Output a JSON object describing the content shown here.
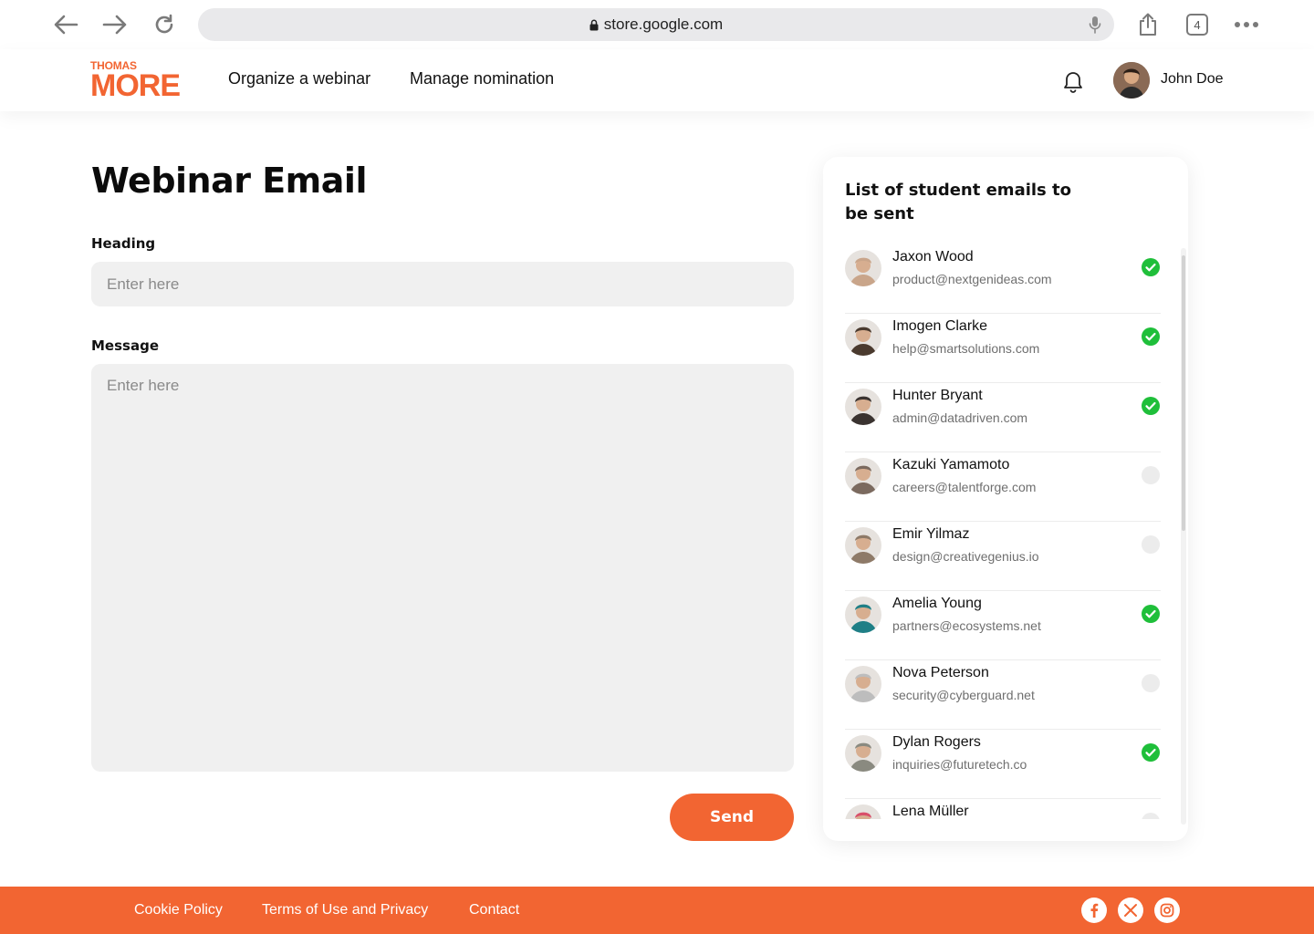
{
  "browser": {
    "url": "store.google.com",
    "tab_count": "4"
  },
  "header": {
    "logo": {
      "top": "THOMAS",
      "main": "MORE"
    },
    "nav": [
      "Organize a webinar",
      "Manage nomination"
    ],
    "user_name": "John Doe"
  },
  "form": {
    "title": "Webinar Email",
    "heading_label": "Heading",
    "heading_placeholder": "Enter here",
    "message_label": "Message",
    "message_placeholder": "Enter here",
    "send_label": "Send"
  },
  "panel": {
    "title": "List of student emails to be sent",
    "students": [
      {
        "name": "Jaxon Wood",
        "email": "product@nextgenideas.com",
        "selected": true,
        "avatar_color": "#c9a58a"
      },
      {
        "name": "Imogen Clarke",
        "email": "help@smartsolutions.com",
        "selected": true,
        "avatar_color": "#4a3a2e"
      },
      {
        "name": "Hunter Bryant",
        "email": "admin@datadriven.com",
        "selected": true,
        "avatar_color": "#3a3330"
      },
      {
        "name": "Kazuki Yamamoto",
        "email": "careers@talentforge.com",
        "selected": false,
        "avatar_color": "#7b6a5f"
      },
      {
        "name": "Emir Yilmaz",
        "email": "design@creativegenius.io",
        "selected": false,
        "avatar_color": "#8e7a68"
      },
      {
        "name": "Amelia Young",
        "email": "partners@ecosystems.net",
        "selected": true,
        "avatar_color": "#1f7f86"
      },
      {
        "name": "Nova Peterson",
        "email": "security@cyberguard.net",
        "selected": false,
        "avatar_color": "#bdbdbd"
      },
      {
        "name": "Dylan Rogers",
        "email": "inquiries@futuretech.co",
        "selected": true,
        "avatar_color": "#8a8a80"
      },
      {
        "name": "Lena Müller",
        "email": "",
        "selected": false,
        "avatar_color": "#d9506a"
      }
    ]
  },
  "footer": {
    "links": [
      "Cookie Policy",
      "Terms of Use and Privacy",
      "Contact"
    ]
  },
  "colors": {
    "brand": "#f26532",
    "check_on": "#1fbf3a",
    "check_off": "#ececec"
  }
}
